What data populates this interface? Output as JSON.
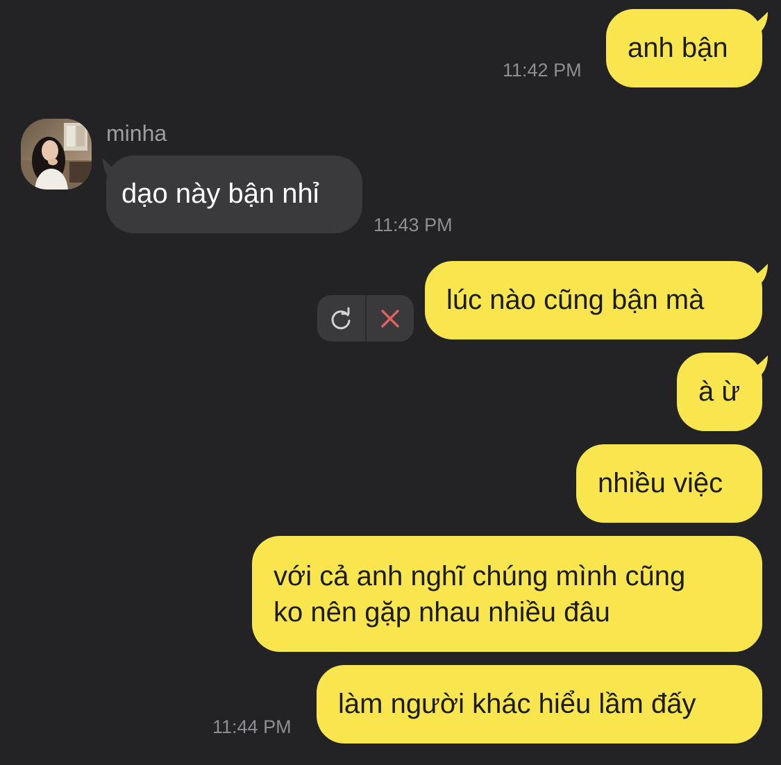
{
  "contact": {
    "name": "minha"
  },
  "messages": [
    {
      "id": "m1",
      "direction": "outgoing",
      "text": "anh bận",
      "time": "11:42 PM"
    },
    {
      "id": "m2",
      "direction": "incoming",
      "text": "dạo này bận nhỉ",
      "time": "11:43 PM"
    },
    {
      "id": "m3",
      "direction": "outgoing",
      "text": "lúc nào cũng bận mà",
      "status": "failed"
    },
    {
      "id": "m4",
      "direction": "outgoing",
      "text": "à ừ"
    },
    {
      "id": "m5",
      "direction": "outgoing",
      "text": "nhiều việc"
    },
    {
      "id": "m6",
      "direction": "outgoing",
      "lines": [
        "với cả anh nghĩ chúng mình cũng",
        "ko nên gặp nhau nhiều đâu"
      ]
    },
    {
      "id": "m7",
      "direction": "outgoing",
      "text": "làm người khác hiểu lầm đấy",
      "time": "11:44 PM"
    }
  ],
  "failed_actions": {
    "retry_icon": "refresh-icon",
    "delete_icon": "close-icon"
  },
  "colors": {
    "background": "#232326",
    "outgoing_bubble": "#f9e54d",
    "incoming_bubble": "#3a3a3d",
    "timestamp": "#8e8e93",
    "delete_accent": "#e0625c"
  }
}
